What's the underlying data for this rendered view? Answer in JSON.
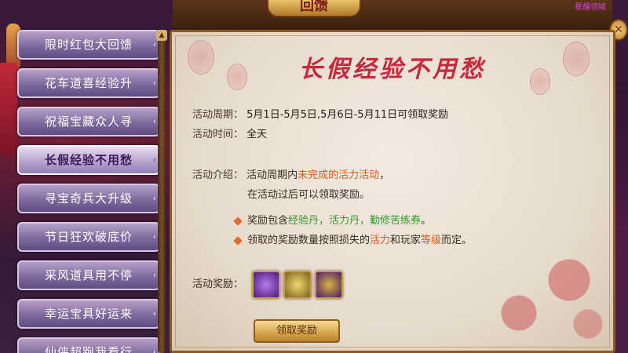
{
  "header": {
    "title": "回馈",
    "corner_text": "星耀领域",
    "close_label": "✕"
  },
  "sidebar": {
    "items": [
      {
        "label": "限时红包大回馈",
        "active": false
      },
      {
        "label": "花车道喜经验升",
        "active": false
      },
      {
        "label": "祝福宝藏众人寻",
        "active": false
      },
      {
        "label": "长假经验不用愁",
        "active": true
      },
      {
        "label": "寻宝奇兵大升级",
        "active": false
      },
      {
        "label": "节日狂欢破底价",
        "active": false
      },
      {
        "label": "采风道具用不停",
        "active": false
      },
      {
        "label": "幸运宝具好运来",
        "active": false
      },
      {
        "label": "仙侠超跑我看行",
        "active": false
      }
    ]
  },
  "panel": {
    "title": "长假经验不用愁",
    "period_label": "活动周期：",
    "period_value": "5月1日-5月5日,5月6日-5月11日可领取奖励",
    "time_label": "活动时间：",
    "time_value": "全天",
    "intro_label": "活动介绍：",
    "intro_line1_a": "活动周期内",
    "intro_line1_b": "未完成的活力活动",
    "intro_line1_c": "，",
    "intro_line2": "在活动过后可以领取奖励。",
    "bullet1_a": "奖励包含",
    "bullet1_b": "经验丹，活力丹，勤修苦练券",
    "bullet1_c": "。",
    "bullet2_a": "领取的奖励数量按照损失的",
    "bullet2_b": "活力",
    "bullet2_c": "和玩家",
    "bullet2_d": "等级",
    "bullet2_e": "而定。",
    "reward_label": "活动奖励：",
    "rewards": [
      {
        "icon": "ticket-icon",
        "color": "#7a3ac8"
      },
      {
        "icon": "coin-stack-icon",
        "color": "#d8b030"
      },
      {
        "icon": "scroll-icon",
        "color": "#6a2a9a"
      }
    ],
    "claim_label": "领取奖励"
  },
  "colors": {
    "accent_red": "#c8283a",
    "highlight_orange": "#e05a1a",
    "highlight_green": "#2e9a2a"
  }
}
